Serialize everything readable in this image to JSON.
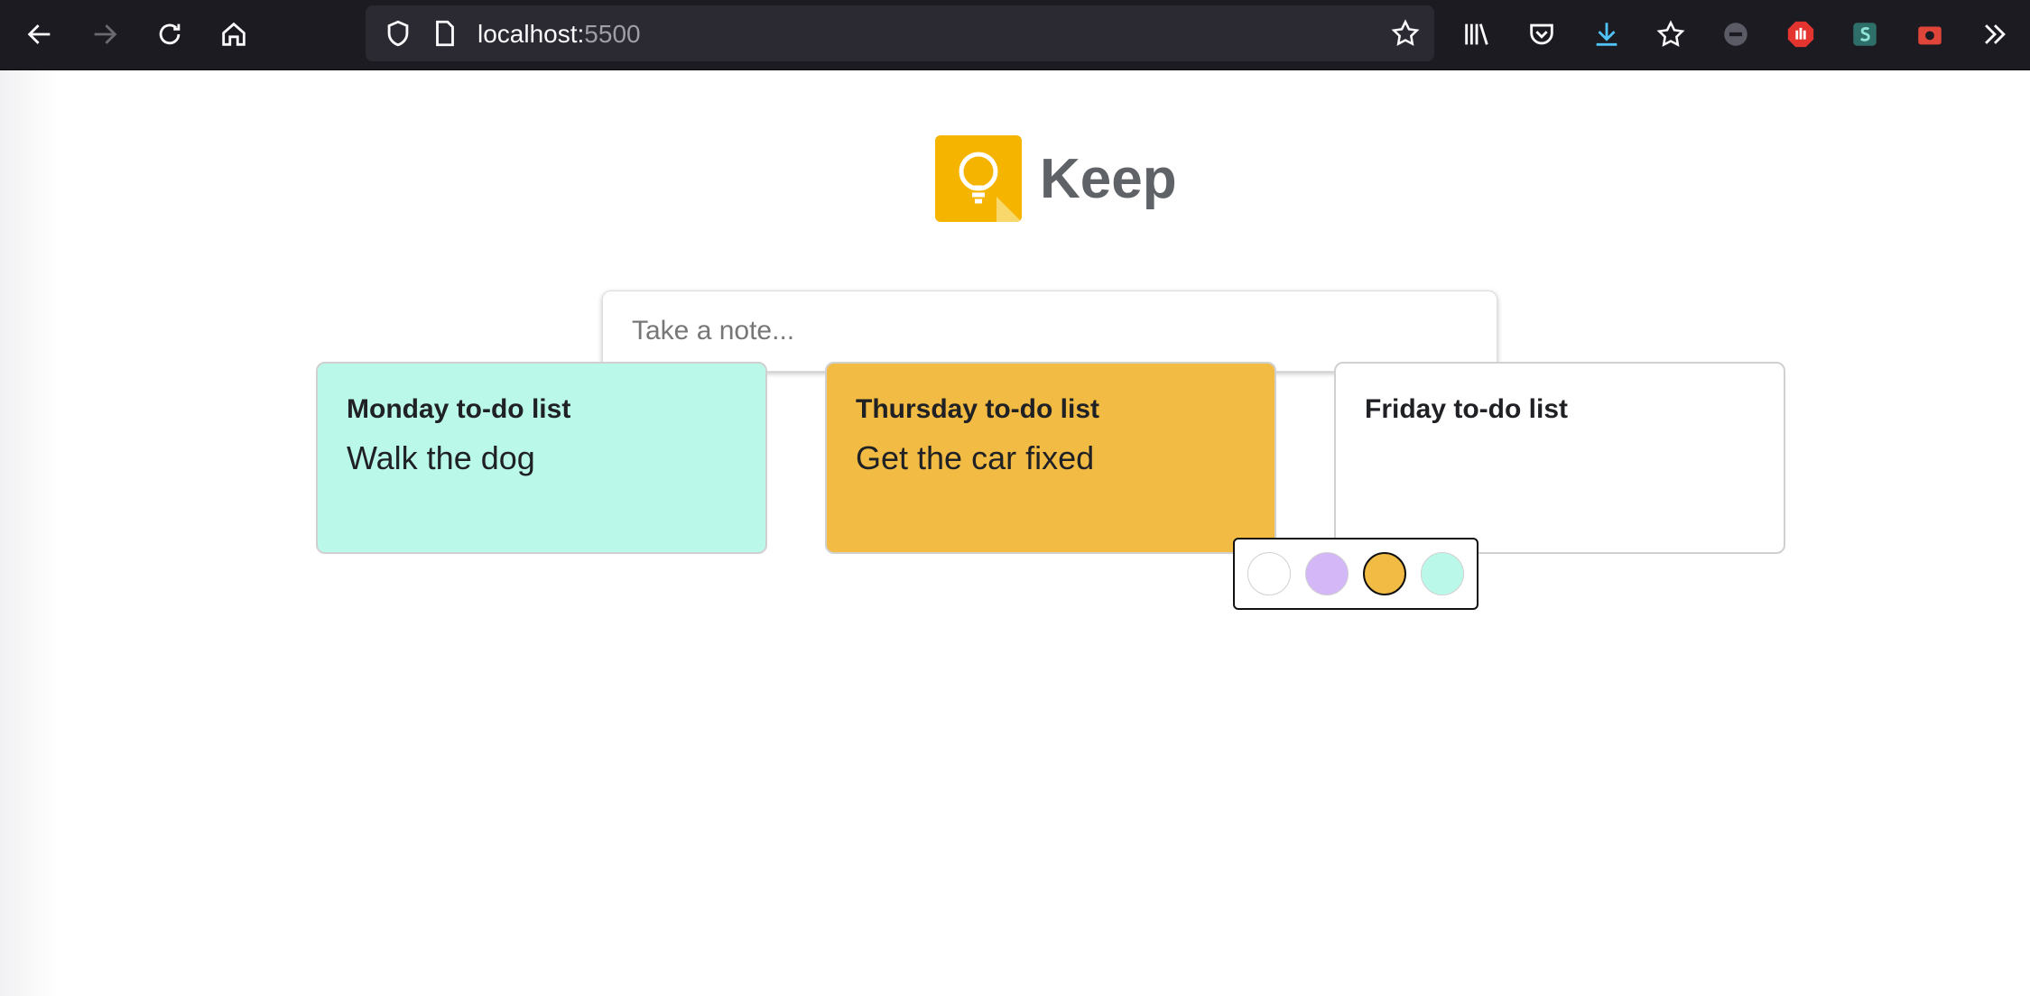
{
  "browser": {
    "url_host": "localhost:",
    "url_port": "5500"
  },
  "app": {
    "title": "Keep",
    "icon": "lightbulb-icon",
    "accent_color": "#f4b400"
  },
  "composer": {
    "placeholder": "Take a note..."
  },
  "notes": [
    {
      "title": "Monday to-do list",
      "body": "Walk the dog",
      "color": "#baf9e9"
    },
    {
      "title": "Thursday to-do list",
      "body": "Get the car fixed",
      "color": "#f2bb43"
    },
    {
      "title": "Friday to-do list",
      "body": "",
      "color": "#ffffff"
    }
  ],
  "color_palette": {
    "colors": [
      "#ffffff",
      "#d3b7f7",
      "#f2bb43",
      "#baf9e9"
    ],
    "selected": "#f2bb43"
  }
}
